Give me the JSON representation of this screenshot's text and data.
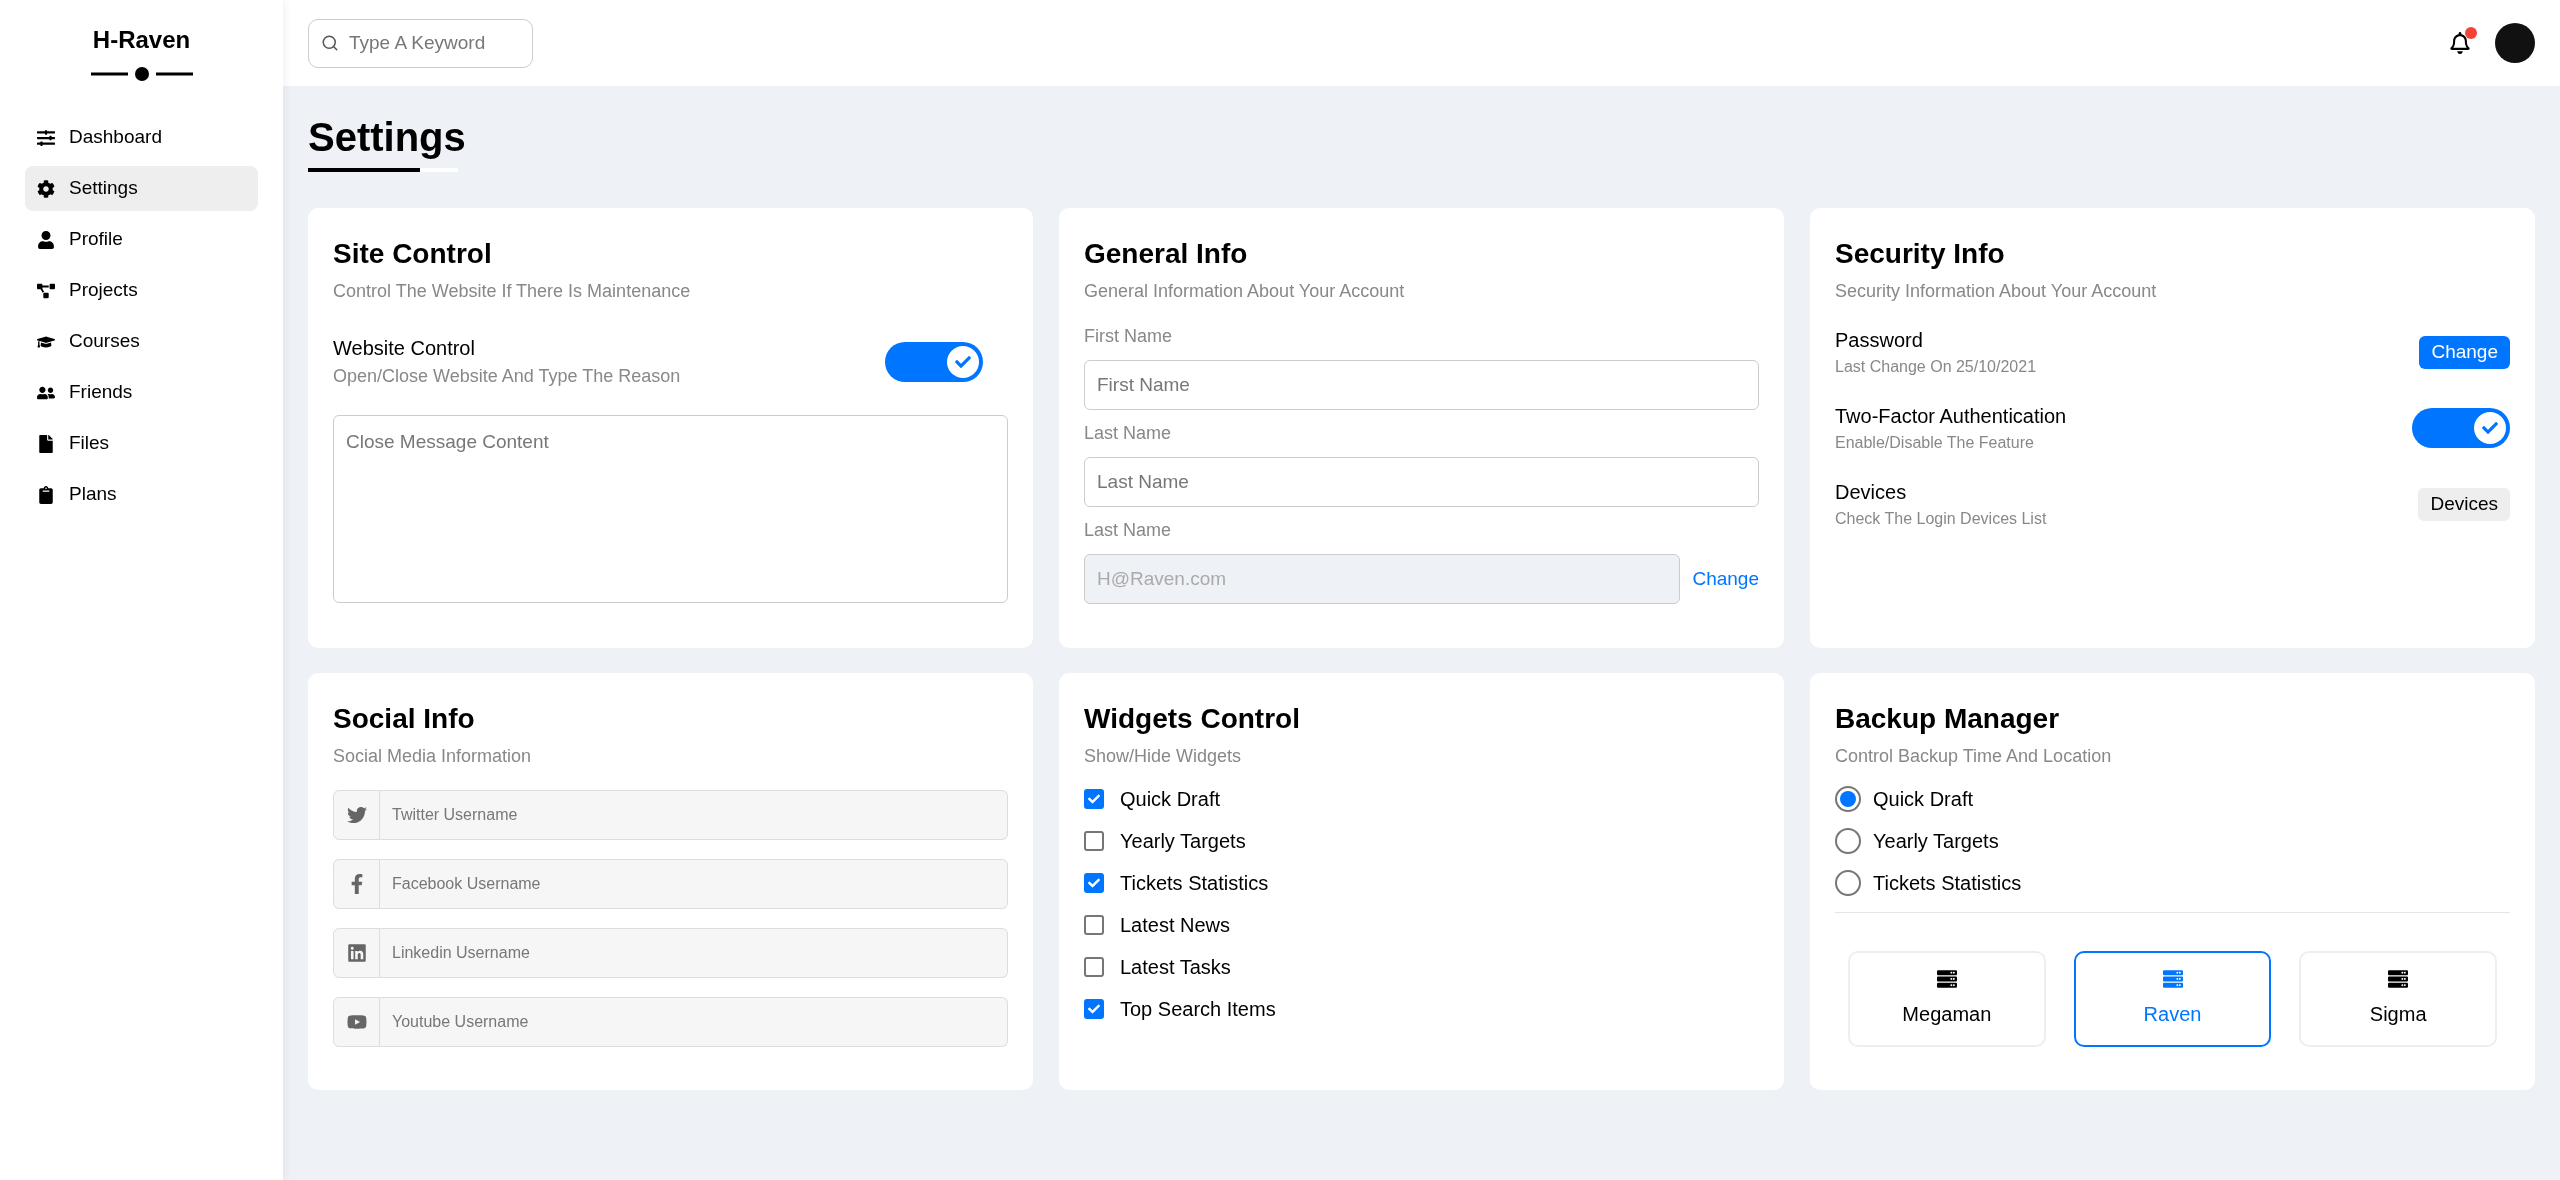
{
  "brand": "H-Raven",
  "sidebar": {
    "items": [
      {
        "label": "Dashboard",
        "selected": false
      },
      {
        "label": "Settings",
        "selected": true
      },
      {
        "label": "Profile",
        "selected": false
      },
      {
        "label": "Projects",
        "selected": false
      },
      {
        "label": "Courses",
        "selected": false
      },
      {
        "label": "Friends",
        "selected": false
      },
      {
        "label": "Files",
        "selected": false
      },
      {
        "label": "Plans",
        "selected": false
      }
    ]
  },
  "search": {
    "placeholder": "Type A Keyword"
  },
  "notifications": {
    "unread": true
  },
  "page_title": "Settings",
  "site_control": {
    "title": "Site Control",
    "subtitle": "Control The Website If There Is Maintenance",
    "toggle": {
      "label": "Website Control",
      "description": "Open/Close Website And Type The Reason",
      "on": true
    },
    "message": {
      "placeholder": "Close Message Content"
    }
  },
  "general_info": {
    "title": "General Info",
    "subtitle": "General Information About Your Account",
    "fields": [
      {
        "label": "First Name",
        "placeholder": "First Name",
        "disabled": false
      },
      {
        "label": "Last Name",
        "placeholder": "Last Name",
        "disabled": false
      },
      {
        "label": "Last Name",
        "value": "H@Raven.com",
        "disabled": true,
        "action": "Change"
      }
    ]
  },
  "security_info": {
    "title": "Security Info",
    "subtitle": "Security Information About Your Account",
    "rows": [
      {
        "kind": "primary",
        "title": "Password",
        "description": "Last Change On 25/10/2021",
        "button": "Change"
      },
      {
        "kind": "toggle",
        "title": "Two-Factor Authentication",
        "description": "Enable/Disable The Feature",
        "on": true
      },
      {
        "kind": "secondary",
        "title": "Devices",
        "description": "Check The Login Devices List",
        "button": "Devices"
      }
    ]
  },
  "social_info": {
    "title": "Social Info",
    "subtitle": "Social Media Information",
    "fields": [
      {
        "placeholder": "Twitter Username"
      },
      {
        "placeholder": "Facebook Username"
      },
      {
        "placeholder": "Linkedin Username"
      },
      {
        "placeholder": "Youtube Username"
      }
    ]
  },
  "widgets_control": {
    "title": "Widgets Control",
    "subtitle": "Show/Hide Widgets",
    "items": [
      {
        "label": "Quick Draft",
        "checked": true
      },
      {
        "label": "Yearly Targets",
        "checked": false
      },
      {
        "label": "Tickets Statistics",
        "checked": true
      },
      {
        "label": "Latest News",
        "checked": false
      },
      {
        "label": "Latest Tasks",
        "checked": false
      },
      {
        "label": "Top Search Items",
        "checked": true
      }
    ]
  },
  "backup_manager": {
    "title": "Backup Manager",
    "subtitle": "Control Backup Time And Location",
    "options": [
      {
        "label": "Quick Draft",
        "selected": true
      },
      {
        "label": "Yearly Targets",
        "selected": false
      },
      {
        "label": "Tickets Statistics",
        "selected": false
      }
    ],
    "servers": [
      {
        "label": "Megaman",
        "selected": false
      },
      {
        "label": "Raven",
        "selected": true
      },
      {
        "label": "Sigma",
        "selected": false
      }
    ]
  }
}
